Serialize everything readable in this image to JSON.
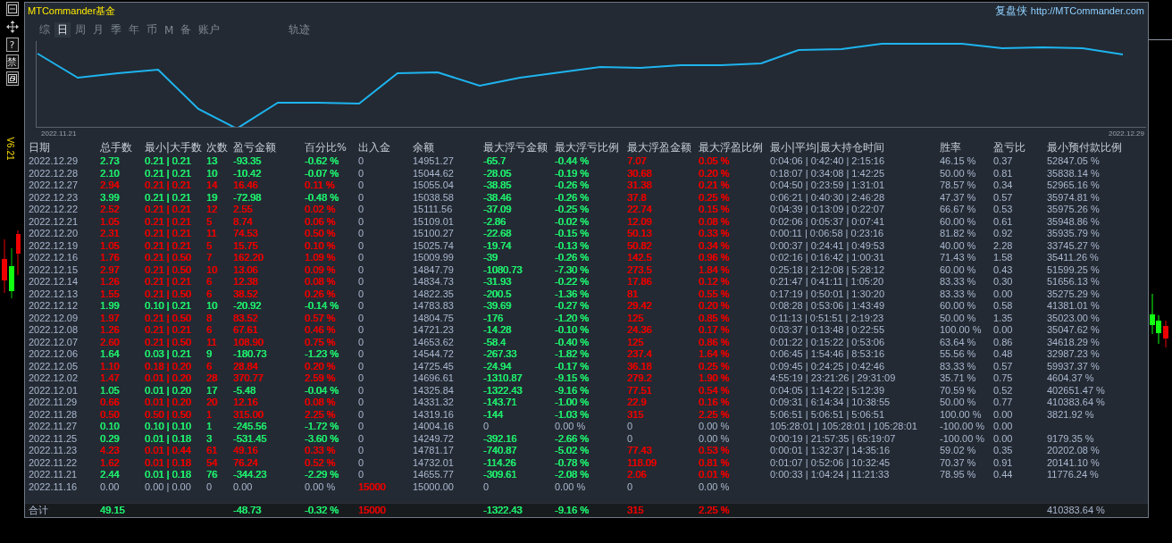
{
  "toolbar": [
    {
      "kind": "minimize"
    },
    {
      "kind": "move"
    },
    {
      "kind": "text",
      "text": "?"
    },
    {
      "kind": "text",
      "text": "禁"
    },
    {
      "kind": "restore"
    }
  ],
  "version": "V6.21",
  "header": {
    "title": "MTCommander基金",
    "brand": "复盘侠",
    "url": "http://MTCommander.com"
  },
  "tabs": [
    {
      "label": "综",
      "selected": false
    },
    {
      "label": "日",
      "selected": true
    },
    {
      "label": "周",
      "selected": false
    },
    {
      "label": "月",
      "selected": false
    },
    {
      "label": "季",
      "selected": false
    },
    {
      "label": "年",
      "selected": false
    },
    {
      "label": "币",
      "selected": false
    },
    {
      "label": "M",
      "selected": false
    },
    {
      "label": "备",
      "selected": false
    },
    {
      "label": "账户",
      "selected": false
    },
    {
      "label": "轨迹",
      "selected": false
    }
  ],
  "chart": {
    "start_label": "2022.11.21",
    "end_label": "2022.12.29"
  },
  "table": {
    "columns": [
      "日期",
      "总手数",
      "最小|大手数",
      "次数",
      "盈亏金额",
      "百分比%",
      "出入金",
      "余额",
      "最大浮亏金额",
      "最大浮亏比例",
      "最大浮盈金额",
      "最大浮盈比例",
      "最小|平均|最大持仓时间",
      "胜率",
      "盈亏比",
      "最小预付款比例"
    ],
    "rows": [
      [
        {
          "text": "2022.12.29"
        },
        {
          "text": "2.73",
          "color": "#1fe96c"
        },
        {
          "text": "0.21 | 0.21",
          "color": "#1fe96c"
        },
        {
          "text": "13",
          "color": "#1fe96c"
        },
        {
          "text": "-93.35",
          "color": "#1fe96c"
        },
        {
          "text": "-0.62 %",
          "color": "#1fe96c"
        },
        {
          "text": "0"
        },
        {
          "text": "14951.27"
        },
        {
          "text": "-65.7",
          "color": "#1fe96c"
        },
        {
          "text": "-0.44 %",
          "color": "#1fe96c"
        },
        {
          "text": "7.07",
          "color": "#e60000"
        },
        {
          "text": "0.05 %",
          "color": "#e60000"
        },
        {
          "text": "0:04:06 | 0:42:40 | 2:15:16"
        },
        {
          "text": "46.15 %"
        },
        {
          "text": "0.37"
        },
        {
          "text": "52847.05 %"
        }
      ],
      [
        {
          "text": "2022.12.28"
        },
        {
          "text": "2.10",
          "color": "#1fe96c"
        },
        {
          "text": "0.21 | 0.21",
          "color": "#1fe96c"
        },
        {
          "text": "10",
          "color": "#1fe96c"
        },
        {
          "text": "-10.42",
          "color": "#1fe96c"
        },
        {
          "text": "-0.07 %",
          "color": "#1fe96c"
        },
        {
          "text": "0"
        },
        {
          "text": "15044.62"
        },
        {
          "text": "-28.05",
          "color": "#1fe96c"
        },
        {
          "text": "-0.19 %",
          "color": "#1fe96c"
        },
        {
          "text": "30.68",
          "color": "#e60000"
        },
        {
          "text": "0.20 %",
          "color": "#e60000"
        },
        {
          "text": "0:18:07 | 0:34:08 | 1:42:25"
        },
        {
          "text": "50.00 %"
        },
        {
          "text": "0.81"
        },
        {
          "text": "35838.14 %"
        }
      ],
      [
        {
          "text": "2022.12.27"
        },
        {
          "text": "2.94",
          "color": "#e60000"
        },
        {
          "text": "0.21 | 0.21",
          "color": "#e60000"
        },
        {
          "text": "14",
          "color": "#e60000"
        },
        {
          "text": "16.46",
          "color": "#e60000"
        },
        {
          "text": "0.11 %",
          "color": "#e60000"
        },
        {
          "text": "0"
        },
        {
          "text": "15055.04"
        },
        {
          "text": "-38.85",
          "color": "#1fe96c"
        },
        {
          "text": "-0.26 %",
          "color": "#1fe96c"
        },
        {
          "text": "31.38",
          "color": "#e60000"
        },
        {
          "text": "0.21 %",
          "color": "#e60000"
        },
        {
          "text": "0:04:50 | 0:23:59 | 1:31:01"
        },
        {
          "text": "78.57 %"
        },
        {
          "text": "0.34"
        },
        {
          "text": "52965.16 %"
        }
      ],
      [
        {
          "text": "2022.12.23"
        },
        {
          "text": "3.99",
          "color": "#1fe96c"
        },
        {
          "text": "0.21 | 0.21",
          "color": "#1fe96c"
        },
        {
          "text": "19",
          "color": "#1fe96c"
        },
        {
          "text": "-72.98",
          "color": "#1fe96c"
        },
        {
          "text": "-0.48 %",
          "color": "#1fe96c"
        },
        {
          "text": "0"
        },
        {
          "text": "15038.58"
        },
        {
          "text": "-38.46",
          "color": "#1fe96c"
        },
        {
          "text": "-0.26 %",
          "color": "#1fe96c"
        },
        {
          "text": "37.8",
          "color": "#e60000"
        },
        {
          "text": "0.25 %",
          "color": "#e60000"
        },
        {
          "text": "0:06:21 | 0:40:30 | 2:46:28"
        },
        {
          "text": "47.37 %"
        },
        {
          "text": "0.57"
        },
        {
          "text": "35974.81 %"
        }
      ],
      [
        {
          "text": "2022.12.22"
        },
        {
          "text": "2.52",
          "color": "#e60000"
        },
        {
          "text": "0.21 | 0.21",
          "color": "#e60000"
        },
        {
          "text": "12",
          "color": "#e60000"
        },
        {
          "text": "2.55",
          "color": "#e60000"
        },
        {
          "text": "0.02 %",
          "color": "#e60000"
        },
        {
          "text": "0"
        },
        {
          "text": "15111.56"
        },
        {
          "text": "-37.09",
          "color": "#1fe96c"
        },
        {
          "text": "-0.25 %",
          "color": "#1fe96c"
        },
        {
          "text": "22.74",
          "color": "#e60000"
        },
        {
          "text": "0.15 %",
          "color": "#e60000"
        },
        {
          "text": "0:04:39 | 0:13:09 | 0:22:07"
        },
        {
          "text": "66.67 %"
        },
        {
          "text": "0.53"
        },
        {
          "text": "35975.26 %"
        }
      ],
      [
        {
          "text": "2022.12.21"
        },
        {
          "text": "1.05",
          "color": "#e60000"
        },
        {
          "text": "0.21 | 0.21",
          "color": "#e60000"
        },
        {
          "text": "5",
          "color": "#e60000"
        },
        {
          "text": "8.74",
          "color": "#e60000"
        },
        {
          "text": "0.06 %",
          "color": "#e60000"
        },
        {
          "text": "0"
        },
        {
          "text": "15109.01"
        },
        {
          "text": "-2.86",
          "color": "#1fe96c"
        },
        {
          "text": "-0.02 %",
          "color": "#1fe96c"
        },
        {
          "text": "12.09",
          "color": "#e60000"
        },
        {
          "text": "0.08 %",
          "color": "#e60000"
        },
        {
          "text": "0:02:06 | 0:05:37 | 0:07:41"
        },
        {
          "text": "60.00 %"
        },
        {
          "text": "0.61"
        },
        {
          "text": "35948.86 %"
        }
      ],
      [
        {
          "text": "2022.12.20"
        },
        {
          "text": "2.31",
          "color": "#e60000"
        },
        {
          "text": "0.21 | 0.21",
          "color": "#e60000"
        },
        {
          "text": "11",
          "color": "#e60000"
        },
        {
          "text": "74.53",
          "color": "#e60000"
        },
        {
          "text": "0.50 %",
          "color": "#e60000"
        },
        {
          "text": "0"
        },
        {
          "text": "15100.27"
        },
        {
          "text": "-22.68",
          "color": "#1fe96c"
        },
        {
          "text": "-0.15 %",
          "color": "#1fe96c"
        },
        {
          "text": "50.13",
          "color": "#e60000"
        },
        {
          "text": "0.33 %",
          "color": "#e60000"
        },
        {
          "text": "0:00:11 | 0:06:58 | 0:23:16"
        },
        {
          "text": "81.82 %"
        },
        {
          "text": "0.92"
        },
        {
          "text": "35935.79 %"
        }
      ],
      [
        {
          "text": "2022.12.19"
        },
        {
          "text": "1.05",
          "color": "#e60000"
        },
        {
          "text": "0.21 | 0.21",
          "color": "#e60000"
        },
        {
          "text": "5",
          "color": "#e60000"
        },
        {
          "text": "15.75",
          "color": "#e60000"
        },
        {
          "text": "0.10 %",
          "color": "#e60000"
        },
        {
          "text": "0"
        },
        {
          "text": "15025.74"
        },
        {
          "text": "-19.74",
          "color": "#1fe96c"
        },
        {
          "text": "-0.13 %",
          "color": "#1fe96c"
        },
        {
          "text": "50.82",
          "color": "#e60000"
        },
        {
          "text": "0.34 %",
          "color": "#e60000"
        },
        {
          "text": "0:00:37 | 0:24:41 | 0:49:53"
        },
        {
          "text": "40.00 %"
        },
        {
          "text": "2.28"
        },
        {
          "text": "33745.27 %"
        }
      ],
      [
        {
          "text": "2022.12.16"
        },
        {
          "text": "1.76",
          "color": "#e60000"
        },
        {
          "text": "0.21 | 0.50",
          "color": "#e60000"
        },
        {
          "text": "7",
          "color": "#e60000"
        },
        {
          "text": "162.20",
          "color": "#e60000"
        },
        {
          "text": "1.09 %",
          "color": "#e60000"
        },
        {
          "text": "0"
        },
        {
          "text": "15009.99"
        },
        {
          "text": "-39",
          "color": "#1fe96c"
        },
        {
          "text": "-0.26 %",
          "color": "#1fe96c"
        },
        {
          "text": "142.5",
          "color": "#e60000"
        },
        {
          "text": "0.96 %",
          "color": "#e60000"
        },
        {
          "text": "0:02:16 | 0:16:42 | 1:00:31"
        },
        {
          "text": "71.43 %"
        },
        {
          "text": "1.58"
        },
        {
          "text": "35411.26 %"
        }
      ],
      [
        {
          "text": "2022.12.15"
        },
        {
          "text": "2.97",
          "color": "#e60000"
        },
        {
          "text": "0.21 | 0.50",
          "color": "#e60000"
        },
        {
          "text": "10",
          "color": "#e60000"
        },
        {
          "text": "13.06",
          "color": "#e60000"
        },
        {
          "text": "0.09 %",
          "color": "#e60000"
        },
        {
          "text": "0"
        },
        {
          "text": "14847.79"
        },
        {
          "text": "-1080.73",
          "color": "#1fe96c"
        },
        {
          "text": "-7.30 %",
          "color": "#1fe96c"
        },
        {
          "text": "273.5",
          "color": "#e60000"
        },
        {
          "text": "1.84 %",
          "color": "#e60000"
        },
        {
          "text": "0:25:18 | 2:12:08 | 5:28:12"
        },
        {
          "text": "60.00 %"
        },
        {
          "text": "0.43"
        },
        {
          "text": "51599.25 %"
        }
      ],
      [
        {
          "text": "2022.12.14"
        },
        {
          "text": "1.26",
          "color": "#e60000"
        },
        {
          "text": "0.21 | 0.21",
          "color": "#e60000"
        },
        {
          "text": "6",
          "color": "#e60000"
        },
        {
          "text": "12.38",
          "color": "#e60000"
        },
        {
          "text": "0.08 %",
          "color": "#e60000"
        },
        {
          "text": "0"
        },
        {
          "text": "14834.73"
        },
        {
          "text": "-31.93",
          "color": "#1fe96c"
        },
        {
          "text": "-0.22 %",
          "color": "#1fe96c"
        },
        {
          "text": "17.86",
          "color": "#e60000"
        },
        {
          "text": "0.12 %",
          "color": "#e60000"
        },
        {
          "text": "0:21:47 | 0:41:11 | 1:05:20"
        },
        {
          "text": "83.33 %"
        },
        {
          "text": "0.30"
        },
        {
          "text": "51656.13 %"
        }
      ],
      [
        {
          "text": "2022.12.13"
        },
        {
          "text": "1.55",
          "color": "#e60000"
        },
        {
          "text": "0.21 | 0.50",
          "color": "#e60000"
        },
        {
          "text": "6",
          "color": "#e60000"
        },
        {
          "text": "38.52",
          "color": "#e60000"
        },
        {
          "text": "0.26 %",
          "color": "#e60000"
        },
        {
          "text": "0"
        },
        {
          "text": "14822.35"
        },
        {
          "text": "-200.5",
          "color": "#1fe96c"
        },
        {
          "text": "-1.36 %",
          "color": "#1fe96c"
        },
        {
          "text": "81",
          "color": "#e60000"
        },
        {
          "text": "0.55 %",
          "color": "#e60000"
        },
        {
          "text": "0:17:19 | 0:50:01 | 1:30:20"
        },
        {
          "text": "83.33 %"
        },
        {
          "text": "0.00"
        },
        {
          "text": "35275.29 %"
        }
      ],
      [
        {
          "text": "2022.12.12"
        },
        {
          "text": "1.99",
          "color": "#1fe96c"
        },
        {
          "text": "0.10 | 0.21",
          "color": "#1fe96c"
        },
        {
          "text": "10",
          "color": "#1fe96c"
        },
        {
          "text": "-20.92",
          "color": "#1fe96c"
        },
        {
          "text": "-0.14 %",
          "color": "#1fe96c"
        },
        {
          "text": "0"
        },
        {
          "text": "14783.83"
        },
        {
          "text": "-39.69",
          "color": "#1fe96c"
        },
        {
          "text": "-0.27 %",
          "color": "#1fe96c"
        },
        {
          "text": "29.42",
          "color": "#e60000"
        },
        {
          "text": "0.20 %",
          "color": "#e60000"
        },
        {
          "text": "0:08:28 | 0:53:06 | 1:43:49"
        },
        {
          "text": "60.00 %"
        },
        {
          "text": "0.58"
        },
        {
          "text": "41381.01 %"
        }
      ],
      [
        {
          "text": "2022.12.09"
        },
        {
          "text": "1.97",
          "color": "#e60000"
        },
        {
          "text": "0.21 | 0.50",
          "color": "#e60000"
        },
        {
          "text": "8",
          "color": "#e60000"
        },
        {
          "text": "83.52",
          "color": "#e60000"
        },
        {
          "text": "0.57 %",
          "color": "#e60000"
        },
        {
          "text": "0"
        },
        {
          "text": "14804.75"
        },
        {
          "text": "-176",
          "color": "#1fe96c"
        },
        {
          "text": "-1.20 %",
          "color": "#1fe96c"
        },
        {
          "text": "125",
          "color": "#e60000"
        },
        {
          "text": "0.85 %",
          "color": "#e60000"
        },
        {
          "text": "0:11:13 | 0:51:51 | 2:19:23"
        },
        {
          "text": "50.00 %"
        },
        {
          "text": "1.35"
        },
        {
          "text": "35023.00 %"
        }
      ],
      [
        {
          "text": "2022.12.08"
        },
        {
          "text": "1.26",
          "color": "#e60000"
        },
        {
          "text": "0.21 | 0.21",
          "color": "#e60000"
        },
        {
          "text": "6",
          "color": "#e60000"
        },
        {
          "text": "67.61",
          "color": "#e60000"
        },
        {
          "text": "0.46 %",
          "color": "#e60000"
        },
        {
          "text": "0"
        },
        {
          "text": "14721.23"
        },
        {
          "text": "-14.28",
          "color": "#1fe96c"
        },
        {
          "text": "-0.10 %",
          "color": "#1fe96c"
        },
        {
          "text": "24.36",
          "color": "#e60000"
        },
        {
          "text": "0.17 %",
          "color": "#e60000"
        },
        {
          "text": "0:03:37 | 0:13:48 | 0:22:55"
        },
        {
          "text": "100.00 %"
        },
        {
          "text": "0.00"
        },
        {
          "text": "35047.62 %"
        }
      ],
      [
        {
          "text": "2022.12.07"
        },
        {
          "text": "2.60",
          "color": "#e60000"
        },
        {
          "text": "0.21 | 0.50",
          "color": "#e60000"
        },
        {
          "text": "11",
          "color": "#e60000"
        },
        {
          "text": "108.90",
          "color": "#e60000"
        },
        {
          "text": "0.75 %",
          "color": "#e60000"
        },
        {
          "text": "0"
        },
        {
          "text": "14653.62"
        },
        {
          "text": "-58.4",
          "color": "#1fe96c"
        },
        {
          "text": "-0.40 %",
          "color": "#1fe96c"
        },
        {
          "text": "125",
          "color": "#e60000"
        },
        {
          "text": "0.86 %",
          "color": "#e60000"
        },
        {
          "text": "0:01:22 | 0:15:22 | 0:53:06"
        },
        {
          "text": "63.64 %"
        },
        {
          "text": "0.86"
        },
        {
          "text": "34618.29 %"
        }
      ],
      [
        {
          "text": "2022.12.06"
        },
        {
          "text": "1.64",
          "color": "#1fe96c"
        },
        {
          "text": "0.03 | 0.21",
          "color": "#1fe96c"
        },
        {
          "text": "9",
          "color": "#1fe96c"
        },
        {
          "text": "-180.73",
          "color": "#1fe96c"
        },
        {
          "text": "-1.23 %",
          "color": "#1fe96c"
        },
        {
          "text": "0"
        },
        {
          "text": "14544.72"
        },
        {
          "text": "-267.33",
          "color": "#1fe96c"
        },
        {
          "text": "-1.82 %",
          "color": "#1fe96c"
        },
        {
          "text": "237.4",
          "color": "#e60000"
        },
        {
          "text": "1.64 %",
          "color": "#e60000"
        },
        {
          "text": "0:06:45 | 1:54:46 | 8:53:16"
        },
        {
          "text": "55.56 %"
        },
        {
          "text": "0.48"
        },
        {
          "text": "32987.23 %"
        }
      ],
      [
        {
          "text": "2022.12.05"
        },
        {
          "text": "1.10",
          "color": "#e60000"
        },
        {
          "text": "0.18 | 0.20",
          "color": "#e60000"
        },
        {
          "text": "6",
          "color": "#e60000"
        },
        {
          "text": "28.84",
          "color": "#e60000"
        },
        {
          "text": "0.20 %",
          "color": "#e60000"
        },
        {
          "text": "0"
        },
        {
          "text": "14725.45"
        },
        {
          "text": "-24.94",
          "color": "#1fe96c"
        },
        {
          "text": "-0.17 %",
          "color": "#1fe96c"
        },
        {
          "text": "36.18",
          "color": "#e60000"
        },
        {
          "text": "0.25 %",
          "color": "#e60000"
        },
        {
          "text": "0:09:45 | 0:24:25 | 0:42:46"
        },
        {
          "text": "83.33 %"
        },
        {
          "text": "0.57"
        },
        {
          "text": "59937.37 %"
        }
      ],
      [
        {
          "text": "2022.12.02"
        },
        {
          "text": "1.47",
          "color": "#e60000"
        },
        {
          "text": "0.01 | 0.20",
          "color": "#e60000"
        },
        {
          "text": "28",
          "color": "#e60000"
        },
        {
          "text": "370.77",
          "color": "#e60000"
        },
        {
          "text": "2.59 %",
          "color": "#e60000"
        },
        {
          "text": "0"
        },
        {
          "text": "14696.61"
        },
        {
          "text": "-1310.87",
          "color": "#1fe96c"
        },
        {
          "text": "-9.15 %",
          "color": "#1fe96c"
        },
        {
          "text": "279.2",
          "color": "#e60000"
        },
        {
          "text": "1.90 %",
          "color": "#e60000"
        },
        {
          "text": "4:55:19 | 23:21:26 | 29:31:09"
        },
        {
          "text": "35.71 %"
        },
        {
          "text": "0.75"
        },
        {
          "text": "4604.37 %"
        }
      ],
      [
        {
          "text": "2022.12.01"
        },
        {
          "text": "1.05",
          "color": "#1fe96c"
        },
        {
          "text": "0.01 | 0.20",
          "color": "#1fe96c"
        },
        {
          "text": "17",
          "color": "#1fe96c"
        },
        {
          "text": "-5.48",
          "color": "#1fe96c"
        },
        {
          "text": "-0.04 %",
          "color": "#1fe96c"
        },
        {
          "text": "0"
        },
        {
          "text": "14325.84"
        },
        {
          "text": "-1322.43",
          "color": "#1fe96c"
        },
        {
          "text": "-9.16 %",
          "color": "#1fe96c"
        },
        {
          "text": "77.51",
          "color": "#e60000"
        },
        {
          "text": "0.54 %",
          "color": "#e60000"
        },
        {
          "text": "0:04:05 | 1:14:22 | 5:12:39"
        },
        {
          "text": "70.59 %"
        },
        {
          "text": "0.52"
        },
        {
          "text": "402651.47 %"
        }
      ],
      [
        {
          "text": "2022.11.29"
        },
        {
          "text": "0.66",
          "color": "#e60000"
        },
        {
          "text": "0.01 | 0.20",
          "color": "#e60000"
        },
        {
          "text": "20",
          "color": "#e60000"
        },
        {
          "text": "12.16",
          "color": "#e60000"
        },
        {
          "text": "0.08 %",
          "color": "#e60000"
        },
        {
          "text": "0"
        },
        {
          "text": "14331.32"
        },
        {
          "text": "-143.71",
          "color": "#1fe96c"
        },
        {
          "text": "-1.00 %",
          "color": "#1fe96c"
        },
        {
          "text": "22.9",
          "color": "#e60000"
        },
        {
          "text": "0.16 %",
          "color": "#e60000"
        },
        {
          "text": "0:09:31 | 6:14:34 | 10:38:55"
        },
        {
          "text": "50.00 %"
        },
        {
          "text": "0.77"
        },
        {
          "text": "410383.64 %"
        }
      ],
      [
        {
          "text": "2022.11.28"
        },
        {
          "text": "0.50",
          "color": "#e60000"
        },
        {
          "text": "0.50 | 0.50",
          "color": "#e60000"
        },
        {
          "text": "1",
          "color": "#e60000"
        },
        {
          "text": "315.00",
          "color": "#e60000"
        },
        {
          "text": "2.25 %",
          "color": "#e60000"
        },
        {
          "text": "0"
        },
        {
          "text": "14319.16"
        },
        {
          "text": "-144",
          "color": "#1fe96c"
        },
        {
          "text": "-1.03 %",
          "color": "#1fe96c"
        },
        {
          "text": "315",
          "color": "#e60000"
        },
        {
          "text": "2.25 %",
          "color": "#e60000"
        },
        {
          "text": "5:06:51 | 5:06:51 | 5:06:51"
        },
        {
          "text": "100.00 %"
        },
        {
          "text": "0.00"
        },
        {
          "text": "3821.92 %"
        }
      ],
      [
        {
          "text": "2022.11.27"
        },
        {
          "text": "0.10",
          "color": "#1fe96c"
        },
        {
          "text": "0.10 | 0.10",
          "color": "#1fe96c"
        },
        {
          "text": "1",
          "color": "#1fe96c"
        },
        {
          "text": "-245.56",
          "color": "#1fe96c"
        },
        {
          "text": "-1.72 %",
          "color": "#1fe96c"
        },
        {
          "text": "0"
        },
        {
          "text": "14004.16"
        },
        {
          "text": "0"
        },
        {
          "text": "0.00 %"
        },
        {
          "text": "0"
        },
        {
          "text": "0.00 %"
        },
        {
          "text": "105:28:01 | 105:28:01 | 105:28:01"
        },
        {
          "text": "-100.00 %"
        },
        {
          "text": "0.00"
        }
      ],
      [
        {
          "text": "2022.11.25"
        },
        {
          "text": "0.29",
          "color": "#1fe96c"
        },
        {
          "text": "0.01 | 0.18",
          "color": "#1fe96c"
        },
        {
          "text": "3",
          "color": "#1fe96c"
        },
        {
          "text": "-531.45",
          "color": "#1fe96c"
        },
        {
          "text": "-3.60 %",
          "color": "#1fe96c"
        },
        {
          "text": "0"
        },
        {
          "text": "14249.72"
        },
        {
          "text": "-392.16",
          "color": "#1fe96c"
        },
        {
          "text": "-2.66 %",
          "color": "#1fe96c"
        },
        {
          "text": "0"
        },
        {
          "text": "0.00 %"
        },
        {
          "text": "0:00:19 | 21:57:35 | 65:19:07"
        },
        {
          "text": "-100.00 %"
        },
        {
          "text": "0.00"
        },
        {
          "text": "9179.35 %"
        }
      ],
      [
        {
          "text": "2022.11.23"
        },
        {
          "text": "4.23",
          "color": "#e60000"
        },
        {
          "text": "0.01 | 0.44",
          "color": "#e60000"
        },
        {
          "text": "61",
          "color": "#e60000"
        },
        {
          "text": "49.16",
          "color": "#e60000"
        },
        {
          "text": "0.33 %",
          "color": "#e60000"
        },
        {
          "text": "0"
        },
        {
          "text": "14781.17"
        },
        {
          "text": "-740.87",
          "color": "#1fe96c"
        },
        {
          "text": "-5.02 %",
          "color": "#1fe96c"
        },
        {
          "text": "77.43",
          "color": "#e60000"
        },
        {
          "text": "0.53 %",
          "color": "#e60000"
        },
        {
          "text": "0:00:01 | 1:32:37 | 14:35:16"
        },
        {
          "text": "59.02 %"
        },
        {
          "text": "0.35"
        },
        {
          "text": "20202.08 %"
        }
      ],
      [
        {
          "text": "2022.11.22"
        },
        {
          "text": "1.62",
          "color": "#e60000"
        },
        {
          "text": "0.01 | 0.18",
          "color": "#e60000"
        },
        {
          "text": "54",
          "color": "#e60000"
        },
        {
          "text": "76.24",
          "color": "#e60000"
        },
        {
          "text": "0.52 %",
          "color": "#e60000"
        },
        {
          "text": "0"
        },
        {
          "text": "14732.01"
        },
        {
          "text": "-114.26",
          "color": "#1fe96c"
        },
        {
          "text": "-0.78 %",
          "color": "#1fe96c"
        },
        {
          "text": "118.09",
          "color": "#e60000"
        },
        {
          "text": "0.81 %",
          "color": "#e60000"
        },
        {
          "text": "0:01:07 | 0:52:06 | 10:32:45"
        },
        {
          "text": "70.37 %"
        },
        {
          "text": "0.91"
        },
        {
          "text": "20141.10 %"
        }
      ],
      [
        {
          "text": "2022.11.21"
        },
        {
          "text": "2.44",
          "color": "#1fe96c"
        },
        {
          "text": "0.01 | 0.18",
          "color": "#1fe96c"
        },
        {
          "text": "76",
          "color": "#1fe96c"
        },
        {
          "text": "-344.23",
          "color": "#1fe96c"
        },
        {
          "text": "-2.29 %",
          "color": "#1fe96c"
        },
        {
          "text": "0"
        },
        {
          "text": "14655.77"
        },
        {
          "text": "-309.61",
          "color": "#1fe96c"
        },
        {
          "text": "-2.08 %",
          "color": "#1fe96c"
        },
        {
          "text": "2.06",
          "color": "#e60000"
        },
        {
          "text": "0.01 %",
          "color": "#e60000"
        },
        {
          "text": "0:00:33 | 1:04:24 | 11:21:33"
        },
        {
          "text": "78.95 %"
        },
        {
          "text": "0.44"
        },
        {
          "text": "11776.24 %"
        }
      ],
      [
        {
          "text": "2022.11.16"
        },
        {
          "text": "0.00"
        },
        {
          "text": "0.00 | 0.00"
        },
        {
          "text": "0"
        },
        {
          "text": "0.00"
        },
        {
          "text": "0.00 %"
        },
        {
          "text": "15000",
          "color": "#e60000"
        },
        {
          "text": "15000.00"
        },
        {
          "text": "0"
        },
        {
          "text": "0.00 %"
        },
        {
          "text": "0"
        },
        {
          "text": "0.00 %"
        }
      ]
    ],
    "total": {
      "label": {
        "text": "合计"
      },
      "lots": {
        "text": "49.15",
        "color": "#1fe96c"
      },
      "profit": {
        "text": "-48.73",
        "color": "#1fe96c"
      },
      "percent": {
        "text": "-0.32 %",
        "color": "#1fe96c"
      },
      "deposit": {
        "text": "15000",
        "color": "#e60000"
      },
      "max_drawdown": {
        "text": "-1322.43",
        "color": "#1fe96c"
      },
      "max_drawdown_ratio": {
        "text": "-9.16 %",
        "color": "#1fe96c"
      },
      "max_runup": {
        "text": "315",
        "color": "#e60000"
      },
      "max_runup_ratio": {
        "text": "2.25 %",
        "color": "#e60000"
      },
      "min_margin_ratio": {
        "text": "410383.64 %"
      }
    }
  }
}
